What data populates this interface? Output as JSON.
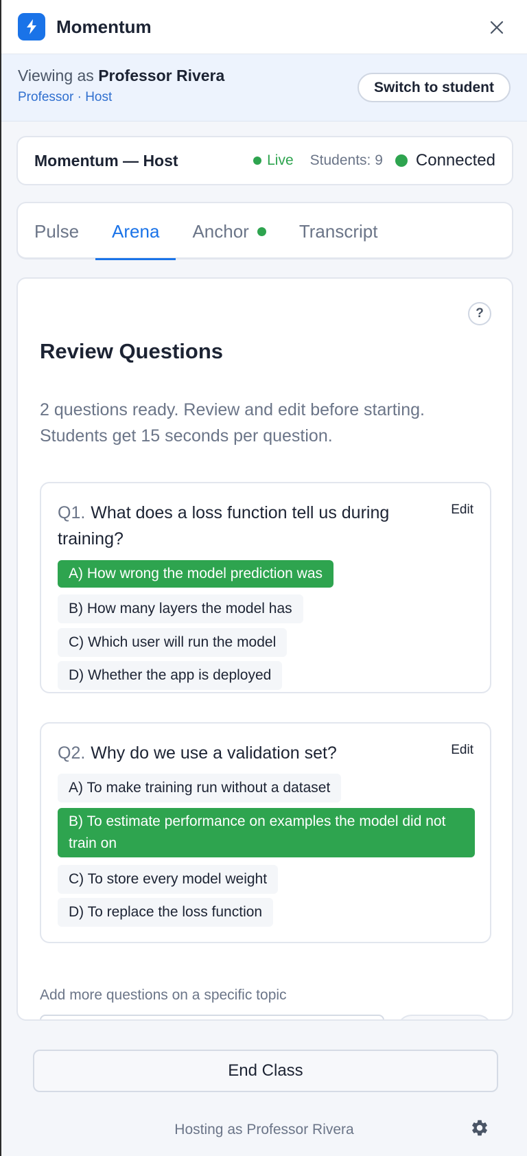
{
  "app": {
    "title": "Momentum"
  },
  "banner": {
    "viewing_prefix": "Viewing as",
    "viewing_name": "Professor Rivera",
    "role_line": "Professor · Host",
    "switch_label": "Switch to student"
  },
  "status": {
    "title": "Momentum — Host",
    "live_label": "Live",
    "students_label": "Students: 9",
    "connection_label": "Connected"
  },
  "tabs": [
    {
      "label": "Pulse",
      "active": false
    },
    {
      "label": "Arena",
      "active": true
    },
    {
      "label": "Anchor",
      "active": false,
      "indicator": true
    },
    {
      "label": "Transcript",
      "active": false
    }
  ],
  "review": {
    "title": "Review Questions",
    "subtitle": "2 questions ready. Review and edit before starting. Students get 15 seconds per question.",
    "edit_label": "Edit",
    "questions": [
      {
        "number": "Q1.",
        "text": "What does a loss function tell us during training?",
        "options": [
          {
            "text": "A) How wrong the model prediction was",
            "correct": true
          },
          {
            "text": "B) How many layers the model has",
            "correct": false
          },
          {
            "text": "C) Which user will run the model",
            "correct": false
          },
          {
            "text": "D) Whether the app is deployed",
            "correct": false
          }
        ]
      },
      {
        "number": "Q2.",
        "text": "Why do we use a validation set?",
        "options": [
          {
            "text": "A) To make training run without a dataset",
            "correct": false
          },
          {
            "text": "B) To estimate performance on examples the model did not train on",
            "correct": true
          },
          {
            "text": "C) To store every model weight",
            "correct": false
          },
          {
            "text": "D) To replace the loss function",
            "correct": false
          }
        ]
      }
    ],
    "add_more_label": "Add more questions on a specific topic"
  },
  "footer": {
    "end_class_label": "End Class",
    "hosting_text": "Hosting as Professor Rivera"
  },
  "colors": {
    "accent": "#1a73e8",
    "success": "#2ea44f",
    "muted_text": "#6b7588"
  }
}
